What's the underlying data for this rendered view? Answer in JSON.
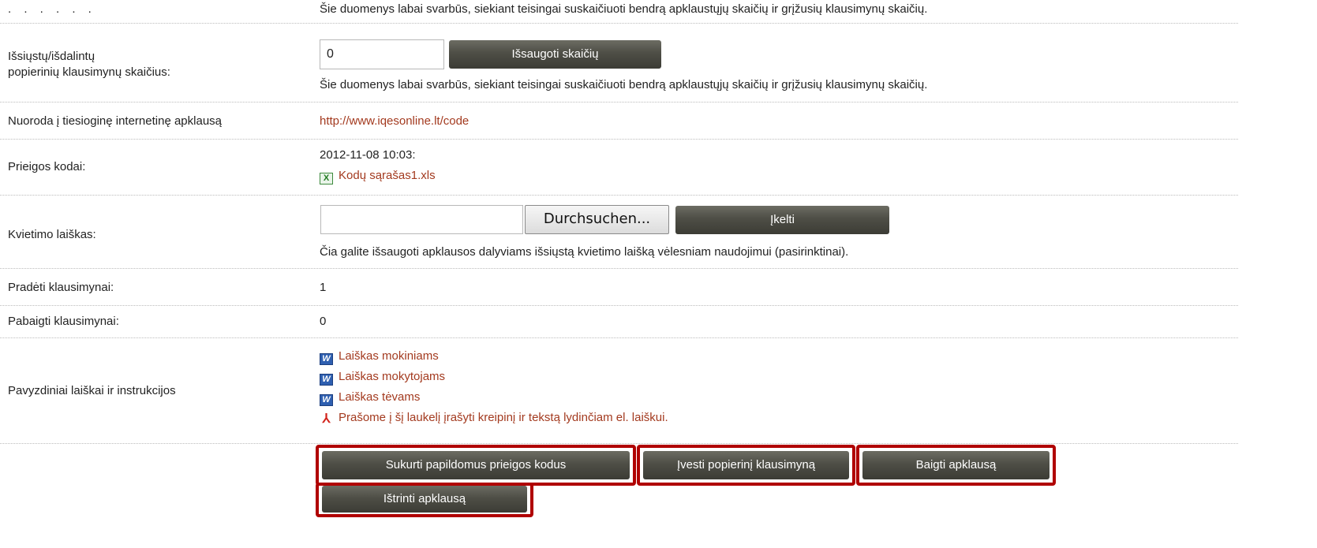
{
  "top_note": "Šie duomenys labai svarbūs, siekiant teisingai suskaičiuoti bendrą apklaustųjų skaičių ir grįžusių klausimynų skaičių.",
  "paper_count": {
    "label_line1": "Išsiųstų/išdalintų",
    "label_line2": "popierinių klausimynų skaičius:",
    "value": "0",
    "save_button": "Išsaugoti skaičių",
    "note": "Šie duomenys labai svarbūs, siekiant teisingai suskaičiuoti bendrą apklaustųjų skaičių ir grįžusių klausimynų skaičių."
  },
  "direct_link": {
    "label": "Nuoroda į tiesioginę internetinę apklausą",
    "url": "http://www.iqesonline.lt/code"
  },
  "access_codes": {
    "label": "Prieigos kodai:",
    "timestamp": "2012-11-08 10:03:",
    "file": "Kodų sąrašas1.xls",
    "file_icon": "excel-icon"
  },
  "invitation": {
    "label": "Kvietimo laiškas:",
    "browse_button": "Durchsuchen...",
    "upload_button": "Įkelti",
    "note": "Čia galite išsaugoti apklausos dalyviams išsiųstą kvietimo laišką vėlesniam naudojimui (pasirinktinai)."
  },
  "started": {
    "label": "Pradėti klausimynai:",
    "value": "1"
  },
  "finished": {
    "label": "Pabaigti klausimynai:",
    "value": "0"
  },
  "samples": {
    "label": "Pavyzdiniai laiškai ir instrukcijos",
    "items": [
      {
        "text": "Laiškas mokiniams",
        "icon": "word-icon"
      },
      {
        "text": "Laiškas mokytojams",
        "icon": "word-icon"
      },
      {
        "text": "Laiškas tėvams",
        "icon": "word-icon"
      },
      {
        "text": "Prašome į šį laukelį įrašyti kreipinį ir tekstą lydinčiam el. laiškui.",
        "icon": "pdf-icon"
      }
    ]
  },
  "actions": {
    "create_codes": "Sukurti papildomus prieigos kodus",
    "enter_paper": "Įvesti popierinį klausimyną",
    "finish": "Baigti apklausą",
    "delete": "Ištrinti apklausą"
  },
  "colors": {
    "link": "#a33a1f",
    "button": "#4e4e46",
    "highlight": "#b00000"
  }
}
